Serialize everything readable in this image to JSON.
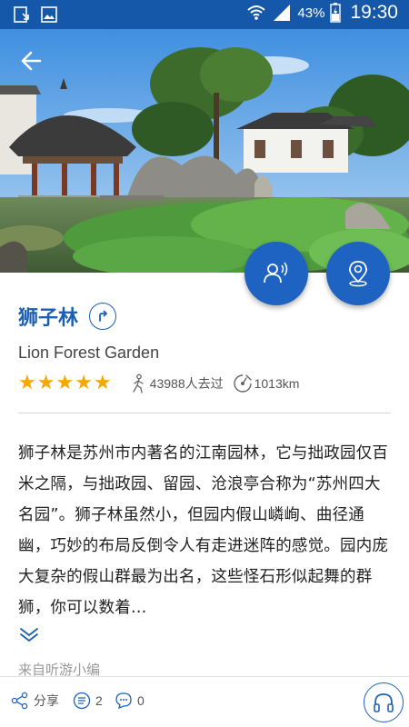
{
  "status_bar": {
    "battery_percent": "43%",
    "time": "19:30",
    "icons": [
      "download-icon",
      "image-icon",
      "wifi-icon",
      "signal-icon",
      "battery-icon"
    ]
  },
  "header": {
    "back_icon": "arrow-left-icon"
  },
  "fabs": {
    "guide_icon": "audio-guide-icon",
    "map_icon": "map-pin-icon",
    "accent_color": "#1e63c1"
  },
  "attraction": {
    "title": "狮子林",
    "subtitle": "Lion Forest Garden",
    "rating": 5,
    "rating_max": 5,
    "visitors": "43988人去过",
    "distance": "1013km",
    "description": "狮子林是苏州市内著名的江南园林，它与拙政园仅百米之隔，与拙政园、留园、沧浪亭合称为“苏州四大名园”。狮子林虽然小，但园内假山嶙峋、曲径通幽，巧妙的布局反倒令人有走进迷阵的感觉。园内庞大复杂的假山群最为出名，这些怪石形似起舞的群狮，你可以数着…",
    "source": "来自听游小编",
    "title_color": "#1a5fb4",
    "star_color": "#f6a700"
  },
  "bottom_bar": {
    "share_label": "分享",
    "comment_count": "2",
    "chat_count": "0"
  }
}
